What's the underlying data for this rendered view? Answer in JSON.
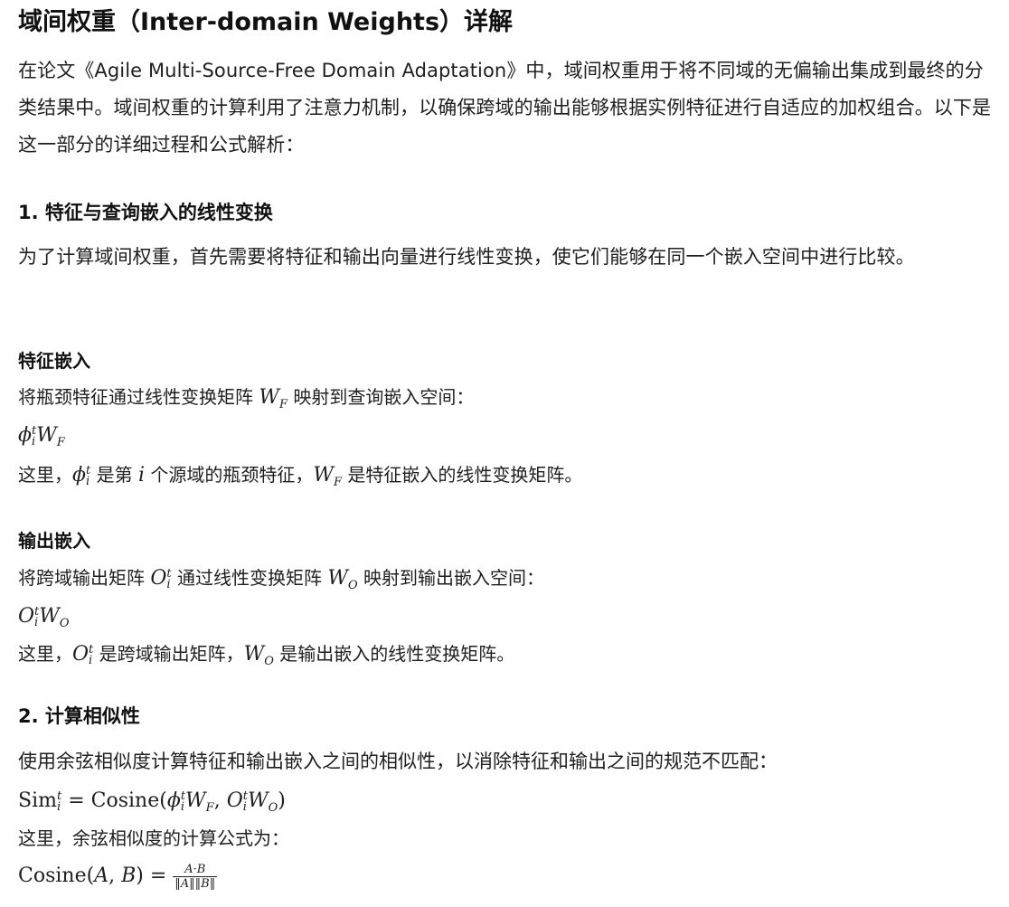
{
  "title": "域间权重（Inter-domain Weights）详解",
  "intro": "在论文《Agile Multi-Source-Free Domain Adaptation》中，域间权重用于将不同域的无偏输出集成到最终的分类结果中。域间权重的计算利用了注意力机制，以确保跨域的输出能够根据实例特征进行自适应的加权组合。以下是这一部分的详细过程和公式解析：",
  "section1": {
    "heading": "1. 特征与查询嵌入的线性变换",
    "text": "为了计算域间权重，首先需要将特征和输出向量进行线性变换，使它们能够在同一个嵌入空间中进行比较。"
  },
  "feature_embedding": {
    "heading": "特征嵌入",
    "line1_a": "将瓶颈特征通过线性变换矩阵",
    "line1_b": "映射到查询嵌入空间：",
    "expl_a": "这里，",
    "expl_b": "是第",
    "expl_c": "个源域的瓶颈特征，",
    "expl_d": "是特征嵌入的线性变换矩阵。"
  },
  "output_embedding": {
    "heading": "输出嵌入",
    "line1_a": "将跨域输出矩阵",
    "line1_b": "通过线性变换矩阵",
    "line1_c": "映射到输出嵌入空间：",
    "expl_a": "这里，",
    "expl_b": "是跨域输出矩阵，",
    "expl_c": "是输出嵌入的线性变换矩阵。"
  },
  "section2": {
    "heading": "2. 计算相似性",
    "text": "使用余弦相似度计算特征和输出嵌入之间的相似性，以消除特征和输出之间的规范不匹配：",
    "expl": "这里，余弦相似度的计算公式为："
  },
  "math": {
    "phi": "ϕ",
    "W": "W",
    "O": "O",
    "sub_F": "F",
    "sub_O": "O",
    "sub_i": "i",
    "sup_t": "t",
    "i": "i",
    "sim": "Sim",
    "cosine": "Cosine",
    "eq": " = ",
    "lparen": "(",
    "rparen": ")",
    "comma": ", ",
    "A": "A",
    "B": "B",
    "frac_num": "A·B",
    "frac_den": "‖A‖‖B‖"
  }
}
